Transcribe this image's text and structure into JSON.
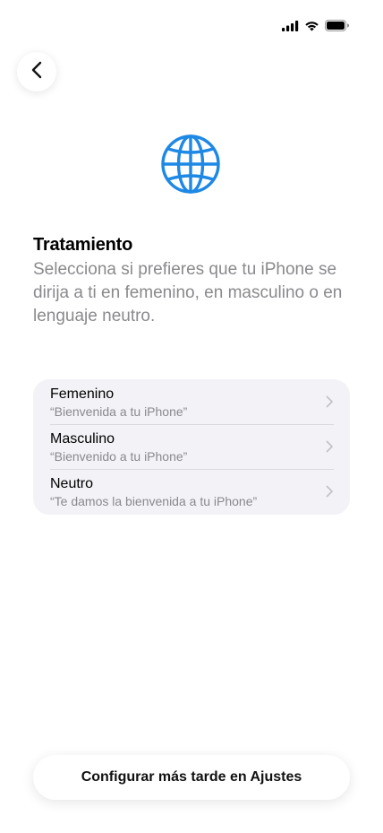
{
  "status_bar": {
    "signal_icon": "cellular-signal-icon",
    "wifi_icon": "wifi-icon",
    "battery_icon": "battery-icon"
  },
  "header": {
    "back_icon": "chevron-left-icon"
  },
  "globe_icon": "globe-icon",
  "accent_color": "#1e88e5",
  "title": "Tratamiento",
  "subtitle": "Selecciona si prefieres que tu iPhone se dirija a ti en femenino, en masculino o en lenguaje neutro.",
  "options": [
    {
      "label": "Femenino",
      "example": "“Bienvenida a tu iPhone”"
    },
    {
      "label": "Masculino",
      "example": "“Bienvenido a tu iPhone”"
    },
    {
      "label": "Neutro",
      "example": "“Te damos la bienvenida a tu iPhone”"
    }
  ],
  "footer": {
    "later_label": "Configurar más tarde en Ajustes"
  }
}
